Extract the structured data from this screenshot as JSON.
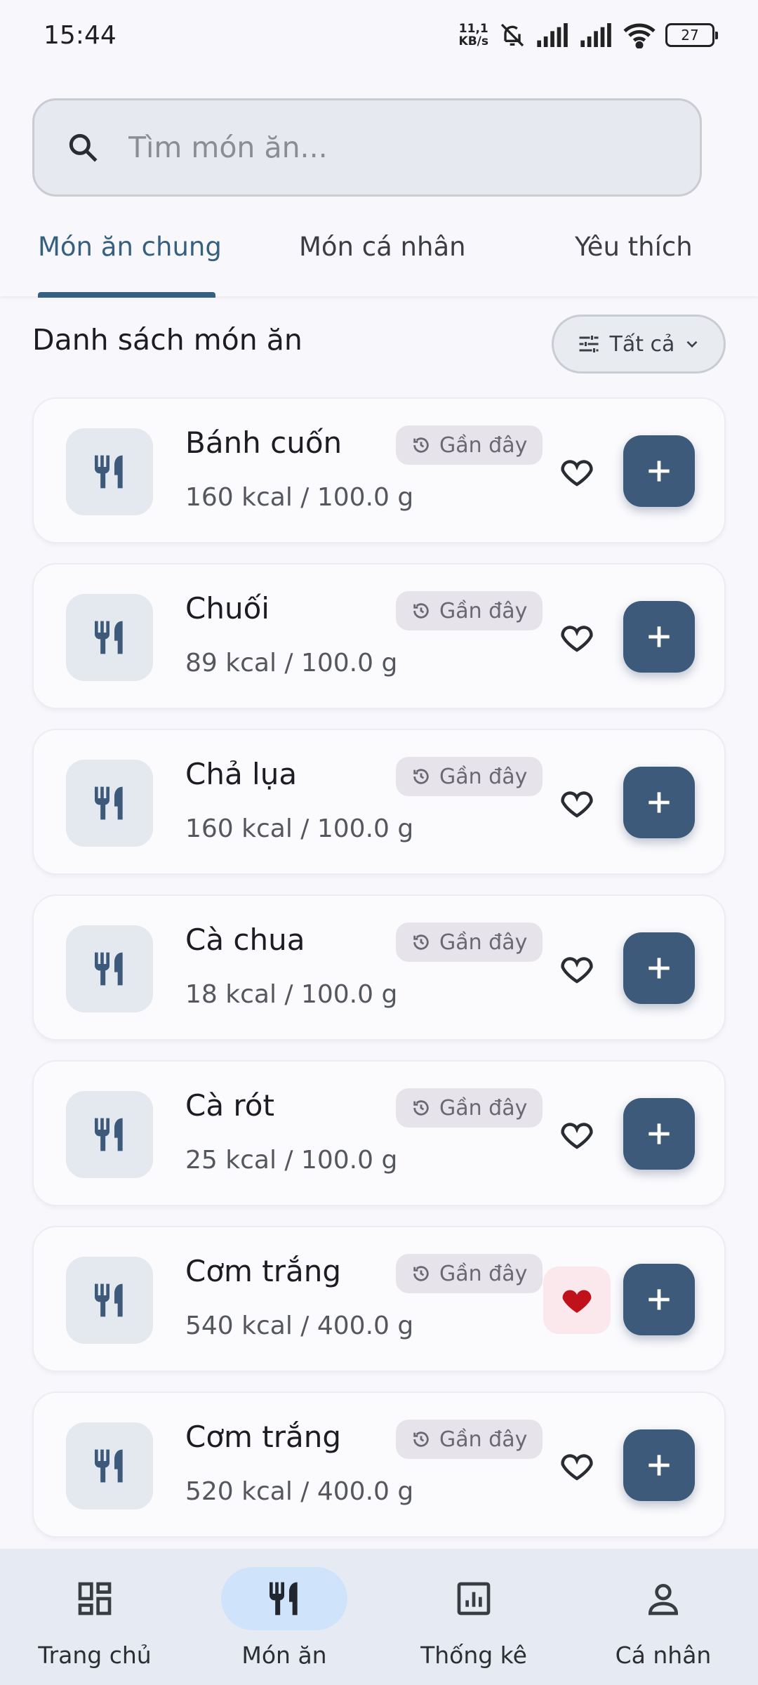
{
  "status_bar": {
    "time": "15:44",
    "net_speed_value": "11,1",
    "net_speed_unit": "KB/s",
    "battery": "27"
  },
  "search": {
    "placeholder": "Tìm món ăn..."
  },
  "tabs": [
    {
      "label": "Món ăn chung",
      "active": true
    },
    {
      "label": "Món cá nhân",
      "active": false
    },
    {
      "label": "Yêu thích",
      "active": false
    }
  ],
  "section": {
    "title": "Danh sách món ăn",
    "filter_label": "Tất cả"
  },
  "foods": [
    {
      "name": "Bánh cuốn",
      "kcal": "160 kcal / 100.0 g",
      "badge": "Gần đây",
      "favorite": false
    },
    {
      "name": "Chuối",
      "kcal": "89 kcal / 100.0 g",
      "badge": "Gần đây",
      "favorite": false
    },
    {
      "name": "Chả lụa",
      "kcal": "160 kcal / 100.0 g",
      "badge": "Gần đây",
      "favorite": false
    },
    {
      "name": "Cà chua",
      "kcal": "18 kcal / 100.0 g",
      "badge": "Gần đây",
      "favorite": false
    },
    {
      "name": "Cà rót",
      "kcal": "25 kcal / 100.0 g",
      "badge": "Gần đây",
      "favorite": false
    },
    {
      "name": "Cơm trắng",
      "kcal": "540 kcal / 400.0 g",
      "badge": "Gần đây",
      "favorite": true
    },
    {
      "name": "Cơm trắng",
      "kcal": "520 kcal / 400.0 g",
      "badge": "Gần đây",
      "favorite": false
    }
  ],
  "bottom_nav": [
    {
      "label": "Trang chủ",
      "icon": "dashboard-icon",
      "active": false
    },
    {
      "label": "Món ăn",
      "icon": "utensils-icon",
      "active": true
    },
    {
      "label": "Thống kê",
      "icon": "chart-icon",
      "active": false
    },
    {
      "label": "Cá nhân",
      "icon": "person-icon",
      "active": false
    }
  ],
  "colors": {
    "primary": "#3e5a7a",
    "tab_active": "#36607f",
    "favorite": "#c0121b",
    "nav_active_bg": "#cfe3fb"
  }
}
